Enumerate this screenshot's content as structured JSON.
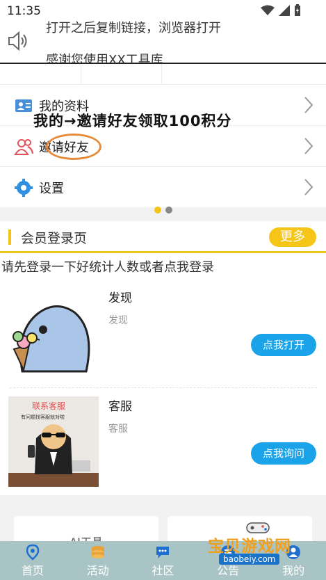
{
  "status_bar": {
    "time": "11:35"
  },
  "notice": {
    "line1": "打开之后复制链接，浏览器打开",
    "line2": "感谢您使用XX工具库"
  },
  "menu": {
    "items": [
      {
        "label": "我的资料",
        "icon": "profile-card-icon"
      },
      {
        "label": "邀请好友",
        "icon": "invite-friends-icon"
      },
      {
        "label": "设置",
        "icon": "settings-gear-icon"
      }
    ]
  },
  "annotation": {
    "text": "我的→邀请好友领取100积分"
  },
  "carousel": {
    "active_index": 0,
    "count": 2
  },
  "member": {
    "title": "会员登录页",
    "more_label": "更多",
    "login_hint": "请先登录一下好统计人数或者点我登录"
  },
  "cards": [
    {
      "title": "发现",
      "subtitle": "发现",
      "button": "点我打开"
    },
    {
      "title": "客服",
      "subtitle": "客服",
      "button": "点我询问",
      "image_caption": "联系客服",
      "image_subcaption": "有问题找客服就对啦"
    }
  ],
  "tools": [
    {
      "label": "AI工具"
    },
    {
      "label": ""
    }
  ],
  "bottom_nav": [
    {
      "label": "首页",
      "icon": "home-pin-icon"
    },
    {
      "label": "活动",
      "icon": "coins-icon"
    },
    {
      "label": "社区",
      "icon": "chat-bubble-icon"
    },
    {
      "label": "公告",
      "icon": "announcement-icon"
    },
    {
      "label": "我的",
      "icon": "user-icon"
    }
  ],
  "watermark": {
    "main": "宝贝游戏网",
    "sub": "baobeiy.com"
  },
  "colors": {
    "accent": "#f5c518",
    "button_blue": "#1aa3e8",
    "nav_bg": "#a9c4c4",
    "circle": "#e58b3a"
  }
}
